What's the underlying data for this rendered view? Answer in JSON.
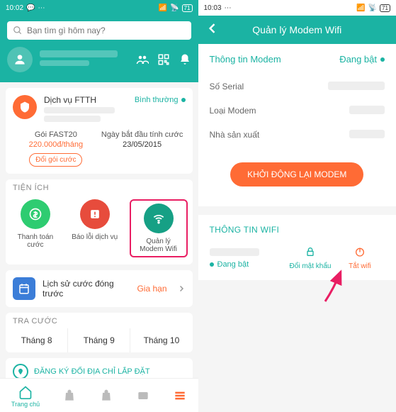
{
  "screen1": {
    "status": {
      "time": "10:02",
      "battery": "71"
    },
    "search": {
      "placeholder": "Bạn tìm gì hôm nay?"
    },
    "service": {
      "name": "Dịch vụ FTTH",
      "status": "Bình thường",
      "plan_label": "Gói FAST20",
      "plan_price": "220.000đ/tháng",
      "change_label": "Đổi gói cước",
      "start_label": "Ngày bắt đầu tính cước",
      "start_date": "23/05/2015"
    },
    "utilities": {
      "title": "TIỆN ÍCH",
      "items": [
        {
          "label": "Thanh toán cước"
        },
        {
          "label": "Báo lỗi dịch vụ"
        },
        {
          "label": "Quản lý Modem Wifi"
        }
      ]
    },
    "history": {
      "text": "Lịch sử cước đóng trước",
      "renew": "Gia hạn"
    },
    "billing": {
      "title": "TRA CƯỚC",
      "months": [
        "Tháng 8",
        "Tháng 9",
        "Tháng 10"
      ]
    },
    "register": "ĐĂNG KÝ ĐỔI ĐỊA CHỈ LẮP ĐẶT",
    "nav": {
      "home": "Trang chủ"
    }
  },
  "screen2": {
    "status": {
      "time": "10:03",
      "battery": "71"
    },
    "title": "Quản lý Modem Wifi",
    "modem_info": {
      "header": "Thông tin Modem",
      "status": "Đang bật",
      "serial_label": "Số Serial",
      "type_label": "Loại Modem",
      "mfr_label": "Nhà sản xuất",
      "restart": "KHỞI ĐỘNG LẠI MODEM"
    },
    "wifi": {
      "title": "THÔNG TIN WIFI",
      "status": "Đang bật",
      "change_pw": "Đổi mật khẩu",
      "turn_off": "Tắt wifi"
    }
  }
}
